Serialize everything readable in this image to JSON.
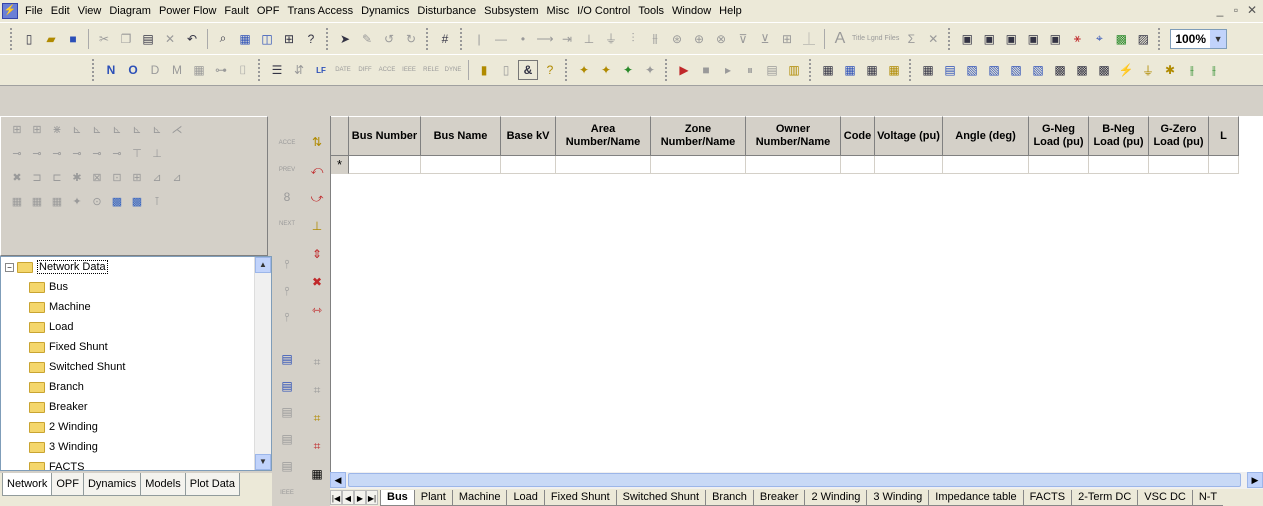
{
  "menu": [
    "File",
    "Edit",
    "View",
    "Diagram",
    "Power Flow",
    "Fault",
    "OPF",
    "Trans Access",
    "Dynamics",
    "Disturbance",
    "Subsystem",
    "Misc",
    "I/O Control",
    "Tools",
    "Window",
    "Help"
  ],
  "window_controls": {
    "minimize": "_",
    "restore": "▫",
    "close": "✕"
  },
  "toolbar": {
    "zoom_value": "100%",
    "annotation_title": "Title",
    "annotation_legend": "Lgnd",
    "annotation_files": "Files"
  },
  "grid": {
    "columns": [
      "Bus Number",
      "Bus Name",
      "Base kV",
      "Area Number/Name",
      "Zone Number/Name",
      "Owner Number/Name",
      "Code",
      "Voltage (pu)",
      "Angle (deg)",
      "G-Neg Load (pu)",
      "B-Neg Load (pu)",
      "G-Zero Load (pu)",
      "L"
    ],
    "new_row_marker": "*"
  },
  "tree": {
    "root": "Network Data",
    "items": [
      "Bus",
      "Machine",
      "Load",
      "Fixed Shunt",
      "Switched Shunt",
      "Branch",
      "Breaker",
      "2 Winding",
      "3 Winding",
      "FACTS"
    ]
  },
  "left_tabs": [
    "Network",
    "OPF",
    "Dynamics",
    "Models",
    "Plot Data"
  ],
  "sheet_tabs": [
    "Bus",
    "Plant",
    "Machine",
    "Load",
    "Fixed Shunt",
    "Switched Shunt",
    "Branch",
    "Breaker",
    "2 Winding",
    "3 Winding",
    "Impedance table",
    "FACTS",
    "2-Term DC",
    "VSC DC",
    "N-T"
  ],
  "strip_labels": {
    "acce": "ACCE",
    "prev": "PREV",
    "next": "NEXT",
    "ieee": "IEEE"
  },
  "toolbar2_labels": {
    "lf": "LF",
    "date": "DATE",
    "diff": "DIFF",
    "acce": "ACCE",
    "ieee": "IEEE",
    "rele": "RELE",
    "dyne": "DYNE",
    "n": "N",
    "o": "O",
    "d": "D",
    "m": "M"
  }
}
